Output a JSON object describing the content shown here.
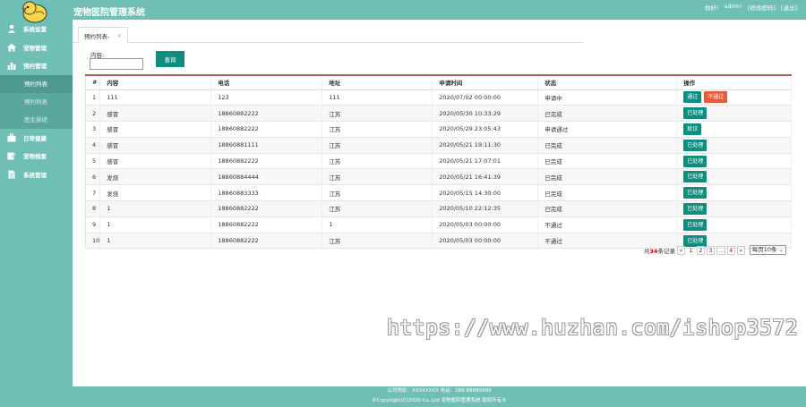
{
  "header": {
    "title": "宠物医院管理系统",
    "greeting": "你好!",
    "user": "admin",
    "change_password": "[修改密码]",
    "logout": "[退出]"
  },
  "sidebar": {
    "items": [
      {
        "label": "系统设置",
        "icon": "user-icon"
      },
      {
        "label": "宠物管理",
        "icon": "home-icon"
      },
      {
        "label": "预约管理",
        "icon": "bar-chart-icon"
      }
    ],
    "subitems": [
      {
        "label": "预约列表",
        "active": true
      },
      {
        "label": "预约列表",
        "active": false
      },
      {
        "label": "医生排班",
        "active": false
      }
    ],
    "items_after": [
      {
        "label": "日常健康",
        "icon": "briefcase-icon"
      },
      {
        "label": "宠物档案",
        "icon": "edit-icon"
      },
      {
        "label": "系统管理",
        "icon": "document-icon"
      }
    ]
  },
  "tab": {
    "label": "预约列表-",
    "close": "×"
  },
  "search": {
    "label": "内容:",
    "value": "",
    "button": "查询"
  },
  "table": {
    "headers": [
      "#",
      "内容",
      "电话",
      "地址",
      "申请时间",
      "状态",
      "操作"
    ],
    "rows": [
      {
        "id": "1",
        "content": "111",
        "phone": "123",
        "address": "111",
        "time": "2020/07/02 00:00:00",
        "status": "申请中",
        "actions": [
          "通过",
          "不通过"
        ]
      },
      {
        "id": "2",
        "content": "感冒",
        "phone": "18860882222",
        "address": "江苏",
        "time": "2020/05/30 10:33:29",
        "status": "已完成",
        "actions": [
          "已处理"
        ]
      },
      {
        "id": "3",
        "content": "感冒",
        "phone": "18860882222",
        "address": "江苏",
        "time": "2020/05/29 23:05:43",
        "status": "申请通过",
        "actions": [
          "就诊"
        ]
      },
      {
        "id": "4",
        "content": "感冒",
        "phone": "18860881111",
        "address": "江苏",
        "time": "2020/05/21 19:11:30",
        "status": "已完成",
        "actions": [
          "已处理"
        ]
      },
      {
        "id": "5",
        "content": "感冒",
        "phone": "18860882222",
        "address": "江苏",
        "time": "2020/05/21 17:07:01",
        "status": "已完成",
        "actions": [
          "已处理"
        ]
      },
      {
        "id": "6",
        "content": "发烧",
        "phone": "18860884444",
        "address": "江苏",
        "time": "2020/05/21 16:41:39",
        "status": "已完成",
        "actions": [
          "已处理"
        ]
      },
      {
        "id": "7",
        "content": "发烧",
        "phone": "18860883333",
        "address": "江苏",
        "time": "2020/05/15 14:30:00",
        "status": "已完成",
        "actions": [
          "已处理"
        ]
      },
      {
        "id": "8",
        "content": "1",
        "phone": "18860882222",
        "address": "江苏",
        "time": "2020/05/10 22:12:35",
        "status": "已完成",
        "actions": [
          "已处理"
        ]
      },
      {
        "id": "9",
        "content": "1",
        "phone": "18860882222",
        "address": "1",
        "time": "2020/05/03 00:00:00",
        "status": "不通过",
        "actions": [
          "已处理"
        ]
      },
      {
        "id": "10",
        "content": "1",
        "phone": "18860882222",
        "address": "江苏",
        "time": "2020/05/03 00:00:00",
        "status": "不通过",
        "actions": [
          "已处理"
        ]
      }
    ]
  },
  "pager": {
    "total_prefix": "共",
    "total": "34",
    "total_suffix": "条记录",
    "prev": "«",
    "pages": [
      "1",
      "2",
      "3",
      "...",
      "4"
    ],
    "next": "»",
    "per_page": "每页10条"
  },
  "watermark": "https://www.huzhan.com/ishop3572",
  "footer": {
    "line1": "公司地址：XXXXXXXX 电话：088-88889999",
    "line2": "©Copyright(C)2020 Co.,Ltd 宠物医院管理系统 版权所有®"
  },
  "colors": {
    "primary": "#6fbfb5",
    "button": "#0e8e7e",
    "danger": "#e85b3a",
    "table_top": "#b95a5a"
  }
}
